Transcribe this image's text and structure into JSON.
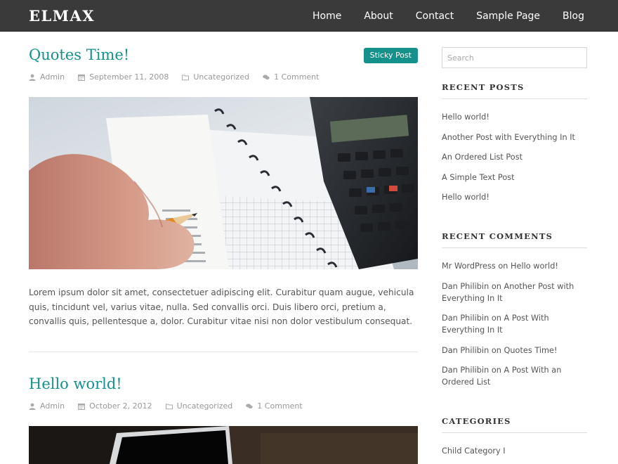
{
  "site": {
    "logo": "ELMAX"
  },
  "nav": {
    "items": [
      "Home",
      "About",
      "Contact",
      "Sample Page",
      "Blog"
    ]
  },
  "posts": [
    {
      "title": "Quotes Time!",
      "sticky_label": "Sticky Post",
      "author": "Admin",
      "date": "September 11, 2008",
      "category": "Uncategorized",
      "comments": "1 Comment",
      "excerpt": "Lorem ipsum dolor sit amet, consectetuer adipiscing elit. Curabitur quam augue, vehicula quis, tincidunt vel, varius vitae, nulla. Sed convallis orci. Duis libero orci, pretium a, convallis quis, pellentesque a, dolor. Curabitur vitae nisi non dolor vestibulum consequat."
    },
    {
      "title": "Hello world!",
      "author": "Admin",
      "date": "October 2, 2012",
      "category": "Uncategorized",
      "comments": "1 Comment"
    }
  ],
  "sidebar": {
    "search_placeholder": "Search",
    "recent_posts": {
      "title": "RECENT POSTS",
      "items": [
        "Hello world!",
        "Another Post with Everything In It",
        "An Ordered List Post",
        "A Simple Text Post",
        "Hello world!"
      ]
    },
    "recent_comments": {
      "title": "RECENT COMMENTS",
      "items": [
        {
          "author": "Mr WordPress",
          "on": "on",
          "post": "Hello world!"
        },
        {
          "author": "Dan Philibin",
          "on": "on",
          "post": "Another Post with Everything In It"
        },
        {
          "author": "Dan Philibin",
          "on": "on",
          "post": "A Post With Everything In It"
        },
        {
          "author": "Dan Philibin",
          "on": "on",
          "post": "Quotes Time!"
        },
        {
          "author": "Dan Philibin",
          "on": "on",
          "post": "A Post With an Ordered List"
        }
      ]
    },
    "categories": {
      "title": "CATEGORIES",
      "items": [
        "Child Category I"
      ]
    }
  },
  "colors": {
    "accent": "#14918a",
    "header_bg": "#3a3a3a"
  }
}
